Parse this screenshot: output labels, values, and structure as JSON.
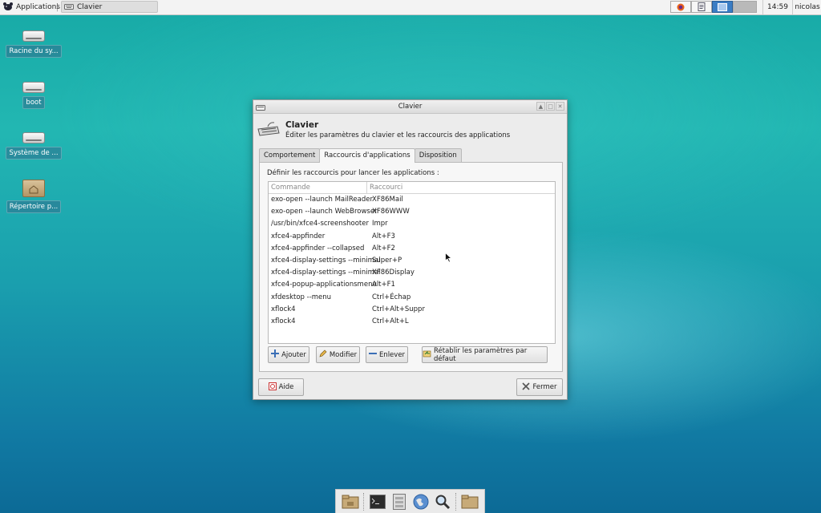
{
  "panel": {
    "apps_label": "Applications",
    "task_label": "Clavier",
    "clock": "14:59",
    "user": "nicolas"
  },
  "desktop": {
    "icons": [
      {
        "label": "Racine du sy...",
        "icon": "drive-icon"
      },
      {
        "label": "boot",
        "icon": "drive-icon"
      },
      {
        "label": "Système de ...",
        "icon": "drive-icon"
      },
      {
        "label": "Répertoire p...",
        "icon": "home-folder-icon"
      }
    ]
  },
  "dialog": {
    "window_title": "Clavier",
    "header_title": "Clavier",
    "header_subtitle": "Éditer les paramètres du clavier et les raccourcis des applications",
    "tabs": [
      {
        "label": "Comportement",
        "active": false
      },
      {
        "label": "Raccourcis d'applications",
        "active": true
      },
      {
        "label": "Disposition",
        "active": false
      }
    ],
    "panel_label": "Définir les raccourcis pour lancer les applications :",
    "columns": {
      "command": "Commande",
      "shortcut": "Raccourci"
    },
    "rows": [
      {
        "command": "exo-open --launch MailReader",
        "shortcut": "XF86Mail"
      },
      {
        "command": "exo-open --launch WebBrowser",
        "shortcut": "XF86WWW"
      },
      {
        "command": "/usr/bin/xfce4-screenshooter",
        "shortcut": "Impr"
      },
      {
        "command": "xfce4-appfinder",
        "shortcut": "Alt+F3"
      },
      {
        "command": "xfce4-appfinder --collapsed",
        "shortcut": "Alt+F2"
      },
      {
        "command": "xfce4-display-settings --minimal",
        "shortcut": "Super+P"
      },
      {
        "command": "xfce4-display-settings --minimal",
        "shortcut": "XF86Display"
      },
      {
        "command": "xfce4-popup-applicationsmenu",
        "shortcut": "Alt+F1"
      },
      {
        "command": "xfdesktop --menu",
        "shortcut": "Ctrl+Échap"
      },
      {
        "command": "xflock4",
        "shortcut": "Ctrl+Alt+Suppr"
      },
      {
        "command": "xflock4",
        "shortcut": "Ctrl+Alt+L"
      }
    ],
    "buttons": {
      "add": "Ajouter",
      "edit": "Modifier",
      "remove": "Enlever",
      "reset": "Rétablir les paramètres par défaut",
      "help": "Aide",
      "close": "Fermer"
    }
  },
  "colors": {
    "accent": "#3b7dc4",
    "desktop_top": "#17a9a6",
    "desktop_bottom": "#0c6a96"
  }
}
